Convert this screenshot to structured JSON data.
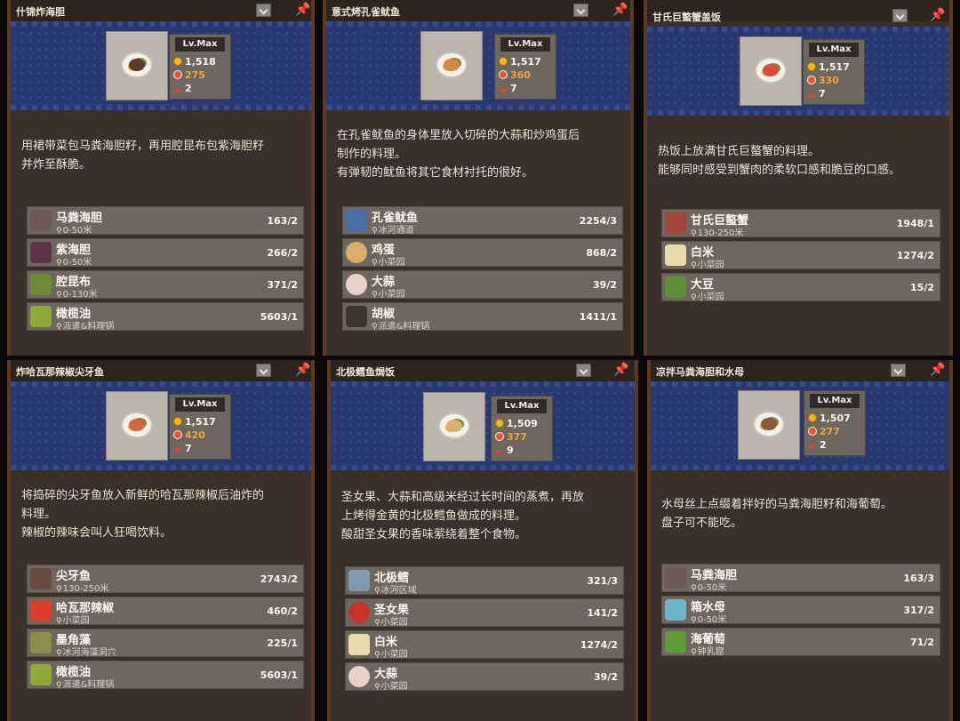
{
  "recipes": [
    {
      "title": "什锦炸海胆",
      "level": "Lv.Max",
      "price": "1,518",
      "taste": "275",
      "amount": "2",
      "dish_color": "#5a3b2c",
      "description": [
        "用裙带菜包马粪海胆籽，再用腔昆布包紫海胆籽",
        "并炸至酥脆。"
      ],
      "ingredients": [
        {
          "name": "马粪海胆",
          "location": "0-50米",
          "count": "163/2",
          "icon": "urchin-icon",
          "color": "#6d5a52"
        },
        {
          "name": "紫海胆",
          "location": "0-50米",
          "count": "266/2",
          "icon": "purple-urchin-icon",
          "color": "#5c3347"
        },
        {
          "name": "腔昆布",
          "location": "0-130米",
          "count": "371/2",
          "icon": "kelp-icon",
          "color": "#6e8a38"
        },
        {
          "name": "橄榄油",
          "location": "派遣&料理锅",
          "count": "5603/1",
          "icon": "olive-oil-icon",
          "color": "#8fa83a"
        }
      ]
    },
    {
      "title": "意式烤孔雀鱿鱼",
      "level": "Lv.Max",
      "price": "1,517",
      "taste": "360",
      "amount": "7",
      "dish_color": "#d0874a",
      "description": [
        "在孔雀鱿鱼的身体里放入切碎的大蒜和炒鸡蛋后",
        "制作的料理。",
        "有弹韧的鱿鱼将其它食材衬托的很好。"
      ],
      "ingredients": [
        {
          "name": "孔雀鱿鱼",
          "location": "冰河通道",
          "count": "2254/3",
          "icon": "squid-icon",
          "color": "#4a6fa8"
        },
        {
          "name": "鸡蛋",
          "location": "小菜园",
          "count": "868/2",
          "icon": "egg-icon",
          "color": "#d9b06a"
        },
        {
          "name": "大蒜",
          "location": "小菜园",
          "count": "39/2",
          "icon": "garlic-icon",
          "color": "#e9d2c8"
        },
        {
          "name": "胡椒",
          "location": "派遣&料理锅",
          "count": "1411/1",
          "icon": "pepper-jar-icon",
          "color": "#3e3430"
        }
      ]
    },
    {
      "title": "甘氏巨螯蟹盖饭",
      "level": "Lv.Max",
      "price": "1,517",
      "taste": "330",
      "amount": "7",
      "dish_color": "#d84e3a",
      "description": [
        "热饭上放满甘氏巨螯蟹的料理。",
        "能够同时感受到蟹肉的柔软口感和脆豆的口感。"
      ],
      "ingredients": [
        {
          "name": "甘氏巨螯蟹",
          "location": "130-250米",
          "count": "1948/1",
          "icon": "crab-icon",
          "color": "#a4473b"
        },
        {
          "name": "白米",
          "location": "小菜园",
          "count": "1274/2",
          "icon": "rice-icon",
          "color": "#e8dcae"
        },
        {
          "name": "大豆",
          "location": "小菜园",
          "count": "15/2",
          "icon": "soybean-icon",
          "color": "#5f8f3a"
        }
      ]
    },
    {
      "title": "炸哈瓦那辣椒尖牙鱼",
      "level": "Lv.Max",
      "price": "1,517",
      "taste": "420",
      "amount": "7",
      "dish_color": "#d3663a",
      "description": [
        "将捣碎的尖牙鱼放入新鲜的哈瓦那辣椒后油炸的",
        "料理。",
        "辣椒的辣味会叫人狂喝饮料。"
      ],
      "ingredients": [
        {
          "name": "尖牙鱼",
          "location": "130-250米",
          "count": "2743/2",
          "icon": "fangtooth-icon",
          "color": "#6b4b3e"
        },
        {
          "name": "哈瓦那辣椒",
          "location": "小菜园",
          "count": "460/2",
          "icon": "chili-icon",
          "color": "#d7402a"
        },
        {
          "name": "墨角藻",
          "location": "冰河海藻洞穴",
          "count": "225/1",
          "icon": "seaweed-icon",
          "color": "#8a8f4a"
        },
        {
          "name": "橄榄油",
          "location": "派遣&料理锅",
          "count": "5603/1",
          "icon": "olive-oil-icon",
          "color": "#8fa83a"
        }
      ]
    },
    {
      "title": "北极鳕鱼焗饭",
      "level": "Lv.Max",
      "price": "1,509",
      "taste": "377",
      "amount": "9",
      "dish_color": "#e0b070",
      "description": [
        "圣女果、大蒜和高级米经过长时间的蒸煮，再放",
        "上烤得金黄的北极鳕鱼做成的料理。",
        "酸甜圣女果的香味萦绕着整个食物。"
      ],
      "ingredients": [
        {
          "name": "北极鳕",
          "location": "冰河区域",
          "count": "321/3",
          "icon": "cod-icon",
          "color": "#7f9bb0"
        },
        {
          "name": "圣女果",
          "location": "小菜园",
          "count": "141/2",
          "icon": "cherry-tomato-icon",
          "color": "#c9312a"
        },
        {
          "name": "白米",
          "location": "小菜园",
          "count": "1274/2",
          "icon": "rice-icon",
          "color": "#e8dcae"
        },
        {
          "name": "大蒜",
          "location": "小菜园",
          "count": "39/2",
          "icon": "garlic-icon",
          "color": "#e9d2c8"
        }
      ]
    },
    {
      "title": "凉拌马粪海胆和水母",
      "level": "Lv.Max",
      "price": "1,507",
      "taste": "277",
      "amount": "2",
      "dish_color": "#8a5a3a",
      "description": [
        "水母丝上点缀着拌好的马粪海胆籽和海葡萄。",
        "盘子可不能吃。"
      ],
      "ingredients": [
        {
          "name": "马粪海胆",
          "location": "0-50米",
          "count": "163/3",
          "icon": "urchin-icon",
          "color": "#6d5a52"
        },
        {
          "name": "箱水母",
          "location": "0-50米",
          "count": "317/2",
          "icon": "jellyfish-icon",
          "color": "#6fb3c8"
        },
        {
          "name": "海葡萄",
          "location": "钟乳窟",
          "count": "71/2",
          "icon": "sea-grape-icon",
          "color": "#5e9a3c"
        }
      ]
    }
  ]
}
